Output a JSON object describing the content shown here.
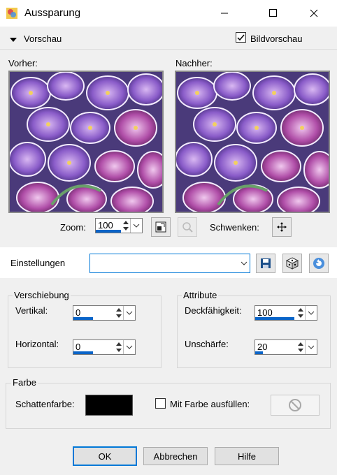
{
  "window": {
    "title": "Aussparung"
  },
  "preview": {
    "section_label": "Vorschau",
    "bildvorschau_label": "Bildvorschau",
    "bildvorschau_checked": true,
    "before_label": "Vorher:",
    "after_label": "Nachher:",
    "zoom_label": "Zoom:",
    "zoom_value": "100",
    "pan_label": "Schwenken:"
  },
  "settings": {
    "label": "Einstellungen",
    "value": ""
  },
  "offset": {
    "group_label": "Verschiebung",
    "vertical_label": "Vertikal:",
    "vertical_value": "0",
    "vertical_fill": 0.5,
    "horizontal_label": "Horizontal:",
    "horizontal_value": "0",
    "horizontal_fill": 0.5
  },
  "attributes": {
    "group_label": "Attribute",
    "opacity_label": "Deckfähigkeit:",
    "opacity_value": "100",
    "opacity_fill": 1.0,
    "blur_label": "Unschärfe:",
    "blur_value": "20",
    "blur_fill": 0.2
  },
  "color": {
    "group_label": "Farbe",
    "shadow_label": "Schattenfarbe:",
    "shadow_color": "#000000",
    "fill_label": "Mit Farbe ausfüllen:",
    "fill_checked": false
  },
  "buttons": {
    "ok": "OK",
    "cancel": "Abbrechen",
    "help": "Hilfe"
  },
  "colors": {
    "accent": "#0a64c8",
    "default_border": "#0078d7"
  }
}
